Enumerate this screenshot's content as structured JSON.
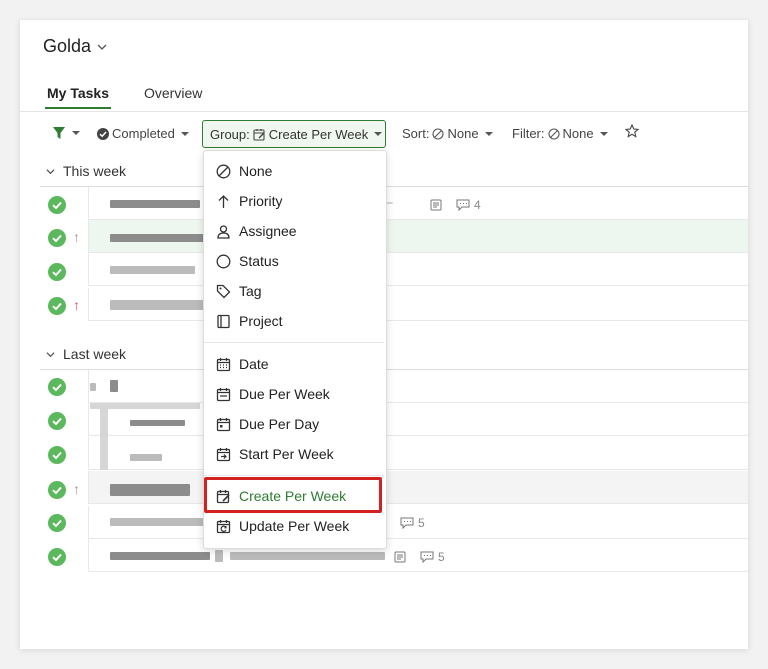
{
  "header": {
    "title": "Golda"
  },
  "tabs": [
    {
      "label": "My Tasks"
    },
    {
      "label": "Overview"
    }
  ],
  "toolbar": {
    "completed_label": "Completed",
    "group_label": "Group:",
    "group_value": "Create Per Week",
    "sort_label": "Sort:",
    "sort_value": "None",
    "filter_label": "Filter:",
    "filter_value": "None"
  },
  "sections": [
    {
      "label": "This week"
    },
    {
      "label": "Last week"
    }
  ],
  "rows_meta": {
    "comment_count_1": "4",
    "comment_count_2": "5",
    "comment_count_3": "5"
  },
  "group_menu": {
    "items": [
      {
        "label": "None",
        "icon": "none-icon"
      },
      {
        "label": "Priority",
        "icon": "arrow-up-icon"
      },
      {
        "label": "Assignee",
        "icon": "person-icon"
      },
      {
        "label": "Status",
        "icon": "circle-icon"
      },
      {
        "label": "Tag",
        "icon": "tag-icon"
      },
      {
        "label": "Project",
        "icon": "notebook-icon"
      },
      {
        "label": "Date",
        "icon": "calendar-icon"
      },
      {
        "label": "Due Per Week",
        "icon": "calendar-week-icon"
      },
      {
        "label": "Due Per Day",
        "icon": "calendar-day-icon"
      },
      {
        "label": "Start Per Week",
        "icon": "calendar-start-icon"
      },
      {
        "label": "Create Per Week",
        "icon": "calendar-create-icon"
      },
      {
        "label": "Update Per Week",
        "icon": "calendar-update-icon"
      }
    ],
    "selected": "Create Per Week"
  },
  "colors": {
    "accent": "#2e7d32",
    "check": "#5cb85c",
    "highlight": "#d32020"
  }
}
